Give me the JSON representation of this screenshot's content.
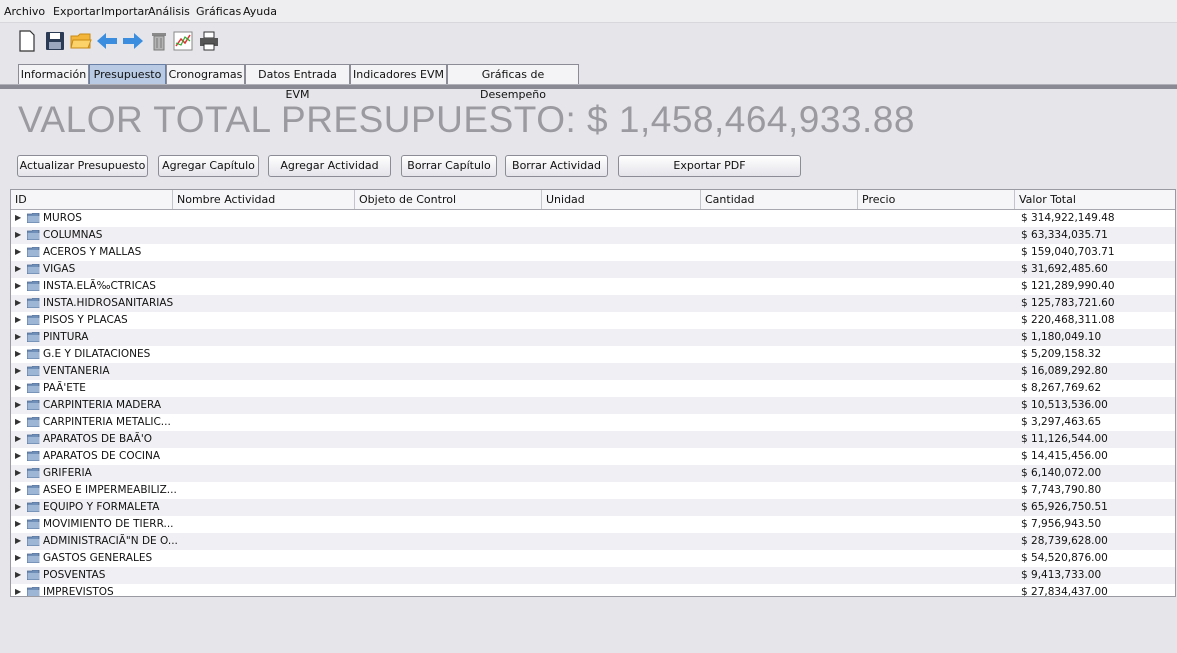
{
  "menu": [
    "Archivo",
    "Exportar",
    "Importar",
    "Análisis",
    "Gráficas",
    "Ayuda"
  ],
  "toolbar_icons": [
    "new-file-icon",
    "save-icon",
    "open-folder-icon",
    "back-arrow-icon",
    "forward-arrow-icon",
    "trash-icon",
    "chart-icon",
    "print-icon"
  ],
  "tabs": [
    {
      "label": "Información",
      "active": false
    },
    {
      "label": "Presupuesto",
      "active": true
    },
    {
      "label": "Cronogramas",
      "active": false
    },
    {
      "label": "Datos Entrada EVM",
      "active": false
    },
    {
      "label": "Indicadores EVM",
      "active": false
    },
    {
      "label": "Gráficas de Desempeño",
      "active": false
    }
  ],
  "title": "VALOR TOTAL PRESUPUESTO:  $ 1,458,464,933.88",
  "buttons": {
    "actualizar": "Actualizar Presupuesto",
    "agregar_capitulo": "Agregar Capítulo",
    "agregar_actividad": "Agregar Actividad",
    "borrar_capitulo": "Borrar Capítulo",
    "borrar_actividad": "Borrar Actividad",
    "exportar_pdf": "Exportar PDF"
  },
  "columns": [
    "ID",
    "Nombre Actividad",
    "Objeto de Control",
    "Unidad",
    "Cantidad",
    "Precio",
    "Valor Total"
  ],
  "rows": [
    {
      "name": "MUROS",
      "value": "$ 314,922,149.48"
    },
    {
      "name": "COLUMNAS",
      "value": "$ 63,334,035.71"
    },
    {
      "name": "ACEROS Y MALLAS",
      "value": "$ 159,040,703.71"
    },
    {
      "name": "VIGAS",
      "value": "$ 31,692,485.60"
    },
    {
      "name": "INSTA.ELÃ‰CTRICAS",
      "value": "$ 121,289,990.40"
    },
    {
      "name": "INSTA.HIDROSANITARIAS",
      "value": "$ 125,783,721.60"
    },
    {
      "name": "PISOS Y PLACAS",
      "value": "$ 220,468,311.08"
    },
    {
      "name": "PINTURA",
      "value": "$ 1,180,049.10"
    },
    {
      "name": "G.E Y DILATACIONES",
      "value": "$ 5,209,158.32"
    },
    {
      "name": "VENTANERIA",
      "value": "$ 16,089,292.80"
    },
    {
      "name": "PAÃ'ETE",
      "value": "$ 8,267,769.62"
    },
    {
      "name": "CARPINTERIA MADERA",
      "value": "$ 10,513,536.00"
    },
    {
      "name": "CARPINTERIA METALIC...",
      "value": "$ 3,297,463.65"
    },
    {
      "name": "APARATOS DE BAÃ'O",
      "value": "$ 11,126,544.00"
    },
    {
      "name": "APARATOS DE COCINA",
      "value": "$ 14,415,456.00"
    },
    {
      "name": "GRIFERIA",
      "value": "$ 6,140,072.00"
    },
    {
      "name": "ASEO E IMPERMEABILIZ...",
      "value": "$ 7,743,790.80"
    },
    {
      "name": "EQUIPO Y FORMALETA",
      "value": "$ 65,926,750.51"
    },
    {
      "name": "MOVIMIENTO DE TIERR...",
      "value": "$ 7,956,943.50"
    },
    {
      "name": "ADMINISTRACIÃ\"N DE O...",
      "value": "$ 28,739,628.00"
    },
    {
      "name": "GASTOS GENERALES",
      "value": "$ 54,520,876.00"
    },
    {
      "name": "POSVENTAS",
      "value": "$ 9,413,733.00"
    },
    {
      "name": "IMPREVISTOS",
      "value": "$ 27,834,437.00"
    }
  ]
}
